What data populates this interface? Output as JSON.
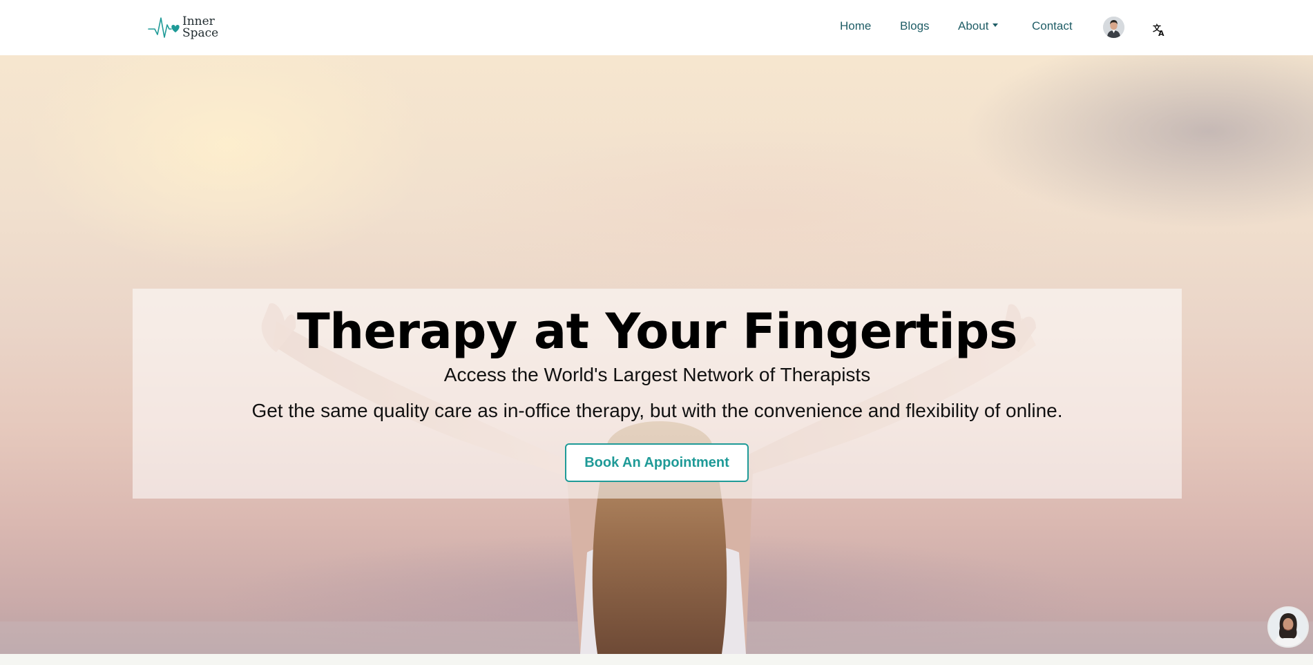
{
  "brand": {
    "name_line1": "Inner",
    "name_line2": "Space",
    "accent_color": "#1e9a97",
    "logo_icon": "heartbeat-heart-icon"
  },
  "nav": {
    "home": "Home",
    "blogs": "Blogs",
    "about": "About",
    "contact": "Contact",
    "link_color": "#1f5d66",
    "profile_icon": "user-avatar",
    "language_icon": "translate-icon"
  },
  "hero": {
    "title": "Therapy at Your Fingertips",
    "subtitle": "Access the World's Largest Network of Therapists",
    "description": "Get the same quality care as in-office therapy, but with the convenience and flexibility of online.",
    "cta_label": "Book An Appointment",
    "background": "sunset-sky-woman-arms-raised-photo"
  },
  "chat": {
    "icon": "chat-assistant-avatar"
  }
}
